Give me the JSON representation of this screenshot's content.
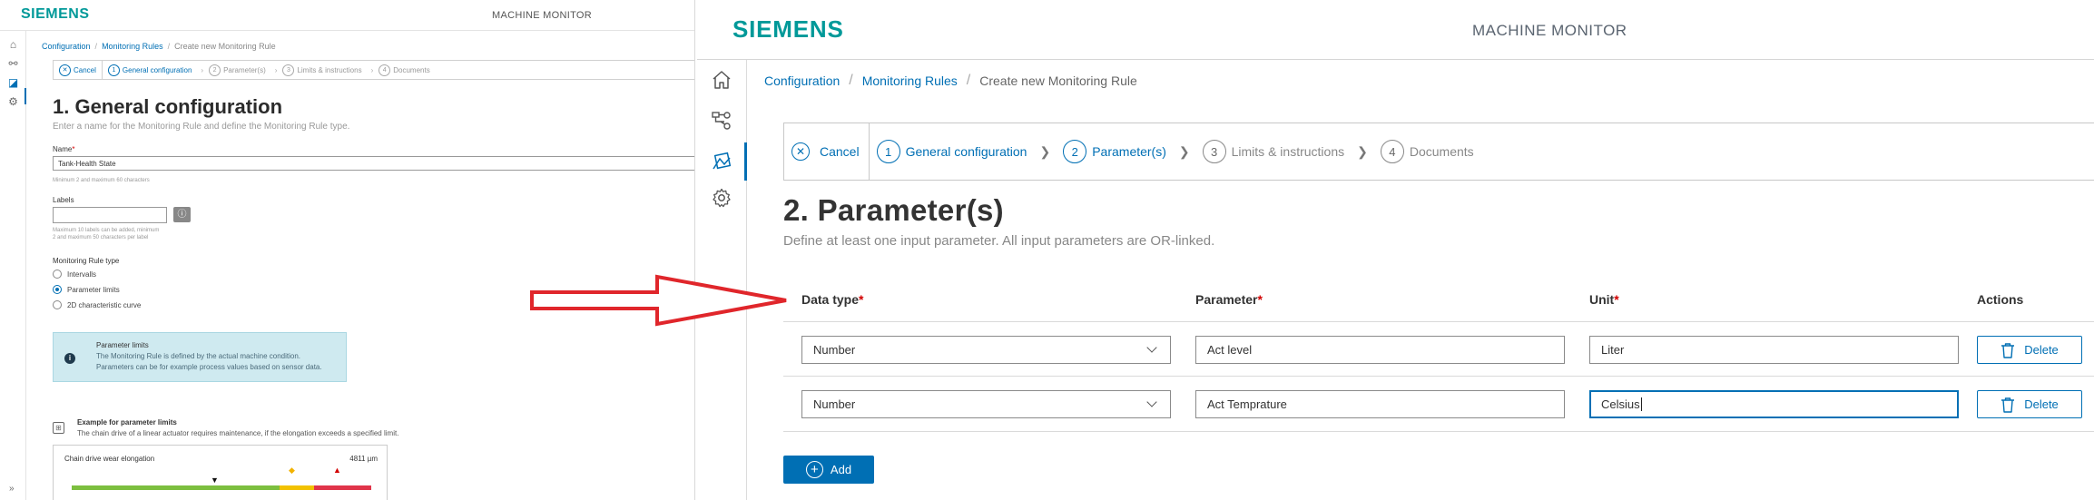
{
  "left": {
    "brand": "SIEMENS",
    "app_title": "MACHINE MONITOR",
    "breadcrumb": [
      "Configuration",
      "Monitoring Rules",
      "Create new Monitoring Rule"
    ],
    "steps": {
      "cancel": "Cancel",
      "items": [
        {
          "num": "1",
          "label": "General configuration"
        },
        {
          "num": "2",
          "label": "Parameter(s)"
        },
        {
          "num": "3",
          "label": "Limits & instructions"
        },
        {
          "num": "4",
          "label": "Documents"
        }
      ]
    },
    "title": "1. General configuration",
    "subtitle": "Enter a name for the Monitoring Rule and define the Monitoring Rule type.",
    "name_label": "Name",
    "name_value": "Tank-Health State",
    "name_hint": "Minimum 2 and maximum 60 characters",
    "labels_label": "Labels",
    "labels_hint_1": "Maximum 10 labels can be added, minimum",
    "labels_hint_2": "2 and maximum 50 characters per label",
    "rule_type_label": "Monitoring Rule type",
    "rule_types": [
      "Intervalls",
      "Parameter limits",
      "2D characteristic curve"
    ],
    "info_title": "Parameter limits",
    "info_text_1": "The Monitoring Rule is defined by the actual machine condition.",
    "info_text_2": "Parameters can be for example process values based on sensor data.",
    "example_title": "Example for parameter limits",
    "example_text": "The chain drive of a linear actuator requires maintenance, if the elongation exceeds a specified limit.",
    "example_chart_title": "Chain drive wear elongation",
    "example_chart_value": "4811 µm"
  },
  "right": {
    "brand": "SIEMENS",
    "app_title": "MACHINE MONITOR",
    "breadcrumb": {
      "item1": "Configuration",
      "item2": "Monitoring Rules",
      "item3": "Create new Monitoring Rule"
    },
    "steps": {
      "cancel": "Cancel",
      "s1_num": "1",
      "s1_label": "General configuration",
      "s2_num": "2",
      "s2_label": "Parameter(s)",
      "s3_num": "3",
      "s3_label": "Limits & instructions",
      "s4_num": "4",
      "s4_label": "Documents"
    },
    "title": "2. Parameter(s)",
    "subtitle": "Define at least one input parameter. All input parameters are OR-linked.",
    "columns": {
      "data_type": "Data type",
      "parameter": "Parameter",
      "unit": "Unit",
      "actions": "Actions",
      "required_mark": "*"
    },
    "rows": [
      {
        "data_type": "Number",
        "parameter": "Act level",
        "unit": "Liter",
        "delete": "Delete"
      },
      {
        "data_type": "Number",
        "parameter": "Act Temprature",
        "unit": "Celsius",
        "delete": "Delete"
      }
    ],
    "add_label": "Add"
  },
  "colors": {
    "brand": "#009999",
    "accent": "#006fb4",
    "required": "#d20000",
    "annotation_arrow": "#e0262b"
  }
}
